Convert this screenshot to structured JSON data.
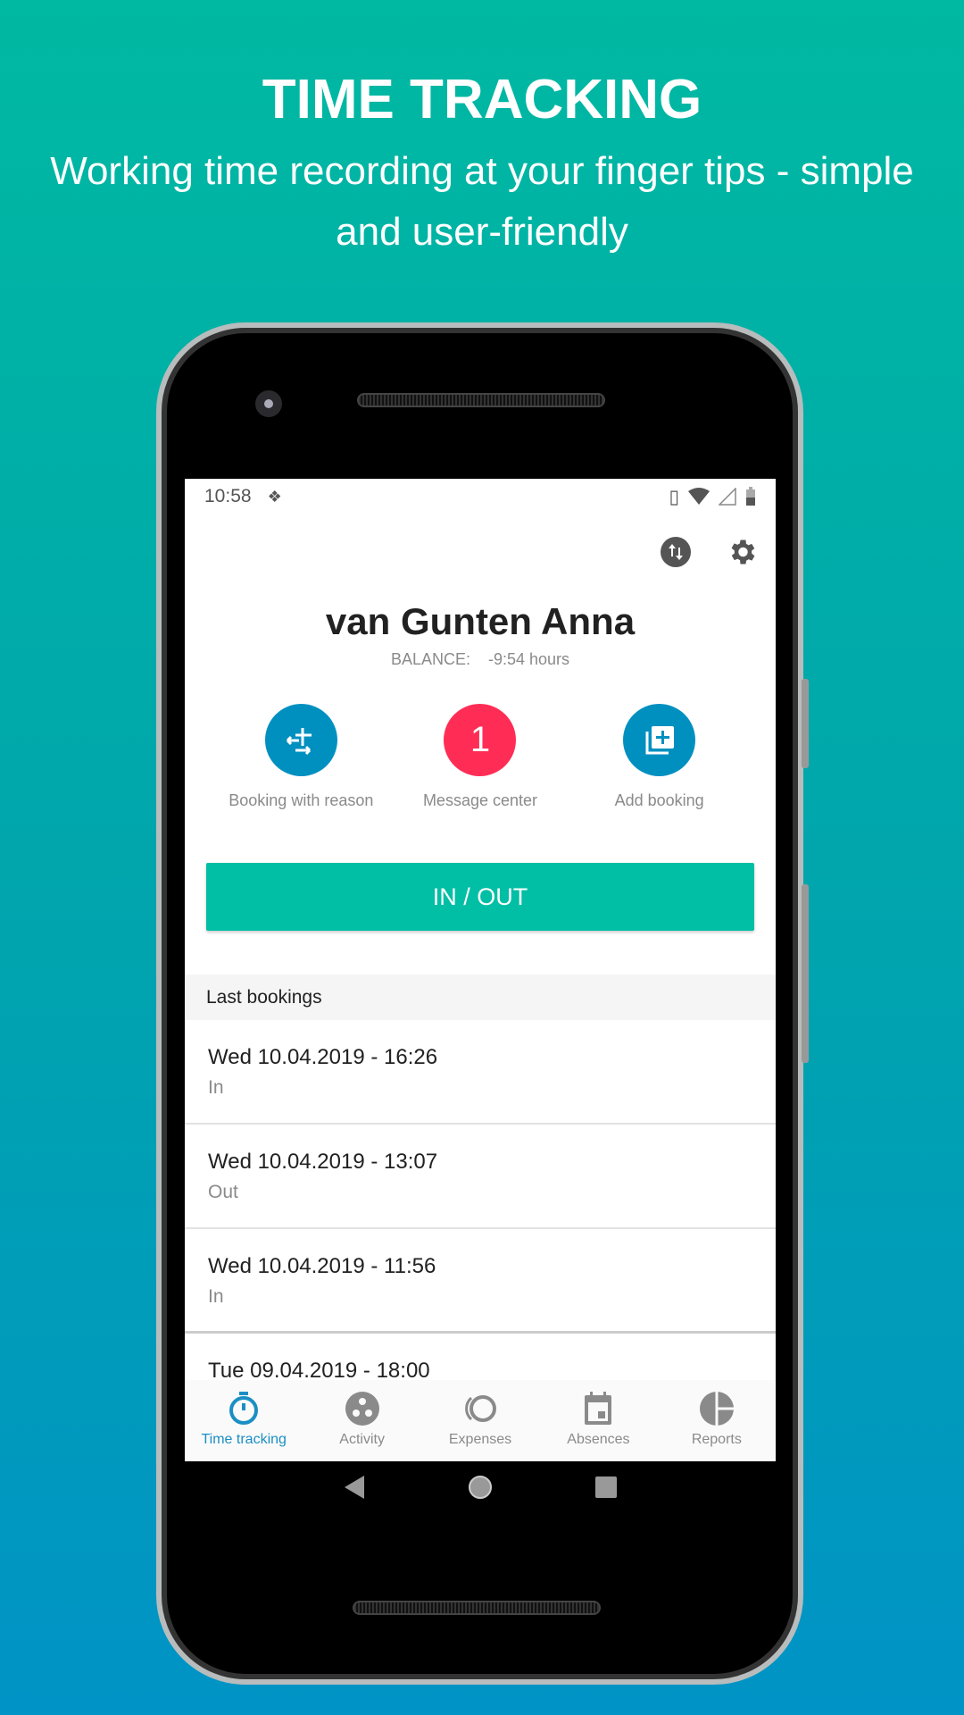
{
  "promo": {
    "title": "TIME TRACKING",
    "subtitle": "Working time recording at your finger tips - simple and user-friendly"
  },
  "status_bar": {
    "time": "10:58",
    "icons": [
      "dropbox-icon",
      "vibrate-icon",
      "wifi-icon",
      "signal-icon",
      "battery-charging-icon"
    ]
  },
  "toolbar": {
    "icons": [
      "sync-icon",
      "gear-icon"
    ]
  },
  "user": {
    "name": "van Gunten Anna",
    "balance_label": "BALANCE:",
    "balance_value": "-9:54 hours"
  },
  "actions": [
    {
      "label": "Booking with reason",
      "icon": "booking-reason-icon",
      "color": "#0090c0"
    },
    {
      "label": "Message center",
      "badge": "1",
      "color": "#ff2d55"
    },
    {
      "label": "Add booking",
      "icon": "add-booking-icon",
      "color": "#0090c0"
    }
  ],
  "inout_label": "IN / OUT",
  "accent": "#00bfa5",
  "last_bookings": {
    "header": "Last bookings",
    "items": [
      {
        "date": "Wed 10.04.2019 - 16:26",
        "type": "In"
      },
      {
        "date": "Wed 10.04.2019 - 13:07",
        "type": "Out"
      },
      {
        "date": "Wed 10.04.2019 - 11:56",
        "type": "In"
      },
      {
        "date": "Tue 09.04.2019 - 18:00",
        "type": ""
      }
    ]
  },
  "bottom_nav": [
    {
      "label": "Time tracking",
      "icon": "stopwatch-icon",
      "active": true
    },
    {
      "label": "Activity",
      "icon": "activity-icon"
    },
    {
      "label": "Expenses",
      "icon": "expenses-icon"
    },
    {
      "label": "Absences",
      "icon": "calendar-icon"
    },
    {
      "label": "Reports",
      "icon": "pie-chart-icon"
    }
  ]
}
